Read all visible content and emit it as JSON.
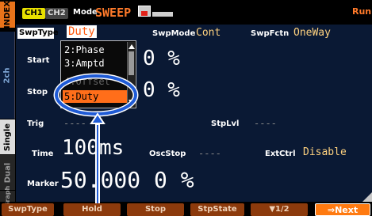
{
  "side_tabs": {
    "index": "INDEX",
    "ch2": "2ch",
    "single": "Single",
    "dual": "Dual",
    "graph": "Graph"
  },
  "header": {
    "ch1": "CH1",
    "ch2": "CH2",
    "mode_label": "Mode",
    "mode_value": "SWEEP",
    "status": "Run"
  },
  "sweep": {
    "swptype_label": "SwpType",
    "swptype_value": "Duty",
    "swpmode_label": "SwpMode",
    "swpmode_value": "Cont",
    "swpfctn_label": "SwpFctn",
    "swpfctn_value": "OneWay",
    "start_label": "Start",
    "start_value": "0 %",
    "stop_label": "Stop",
    "stop_value": "0 %",
    "trig_label": "Trig",
    "trig_value": "----",
    "stplvl_label": "StpLvl",
    "stplvl_value": "----",
    "time_label": "Time",
    "time_value": "100ms",
    "oscstop_label": "OscStop",
    "oscstop_value": "----",
    "extctrl_label": "ExtCtrl",
    "extctrl_value": "Disable",
    "marker_label": "Marker",
    "marker_value": "50.000 0 %"
  },
  "dropdown": {
    "items": [
      "2:Phase",
      "3:Amptd",
      "4:Offset",
      "5:Duty"
    ],
    "selected": "5:Duty"
  },
  "softkeys": {
    "swptype": "SwpType",
    "hold": "Hold",
    "stop": "Stop",
    "stpstate": "StpState",
    "page": "▼1/2",
    "next": "⇒Next"
  },
  "colors": {
    "accent": "#ff7a2a",
    "panel": "#0a1934",
    "highlight_ring": "#1f5bd6"
  }
}
